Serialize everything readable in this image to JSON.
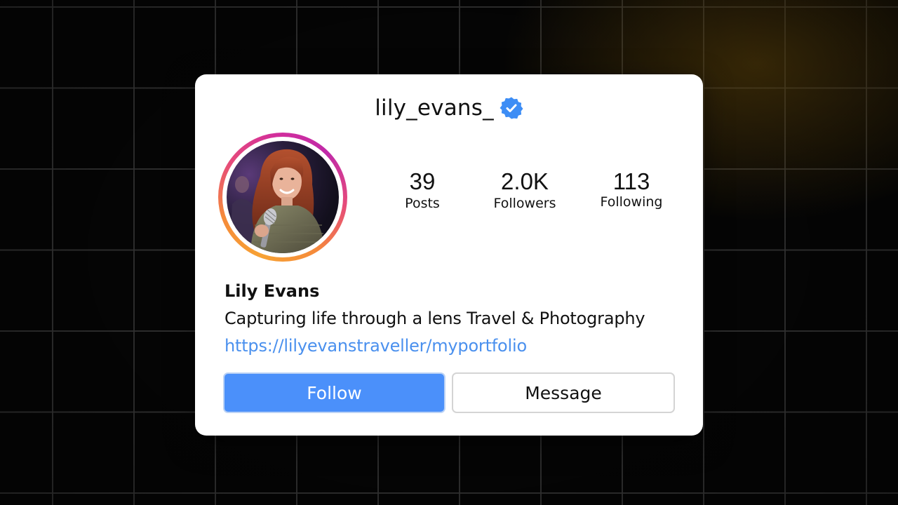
{
  "profile": {
    "username": "lily_evans_",
    "verified": true,
    "full_name": "Lily Evans",
    "bio": "Capturing life through a lens Travel & Photography",
    "link": "https://lilyevanstraveller/myportfolio"
  },
  "stats": {
    "posts": {
      "value": "39",
      "label": "Posts"
    },
    "followers": {
      "value": "2.0K",
      "label": "Followers"
    },
    "following": {
      "value": "113",
      "label": "Following"
    }
  },
  "actions": {
    "follow_label": "Follow",
    "message_label": "Message"
  },
  "icons": {
    "verified": "verified-badge-icon"
  },
  "colors": {
    "accent": "#4b90fa",
    "link": "#4a90ee",
    "verified": "#3d8df5",
    "ring_start": "#f7a234",
    "ring_end": "#c02aa8"
  }
}
